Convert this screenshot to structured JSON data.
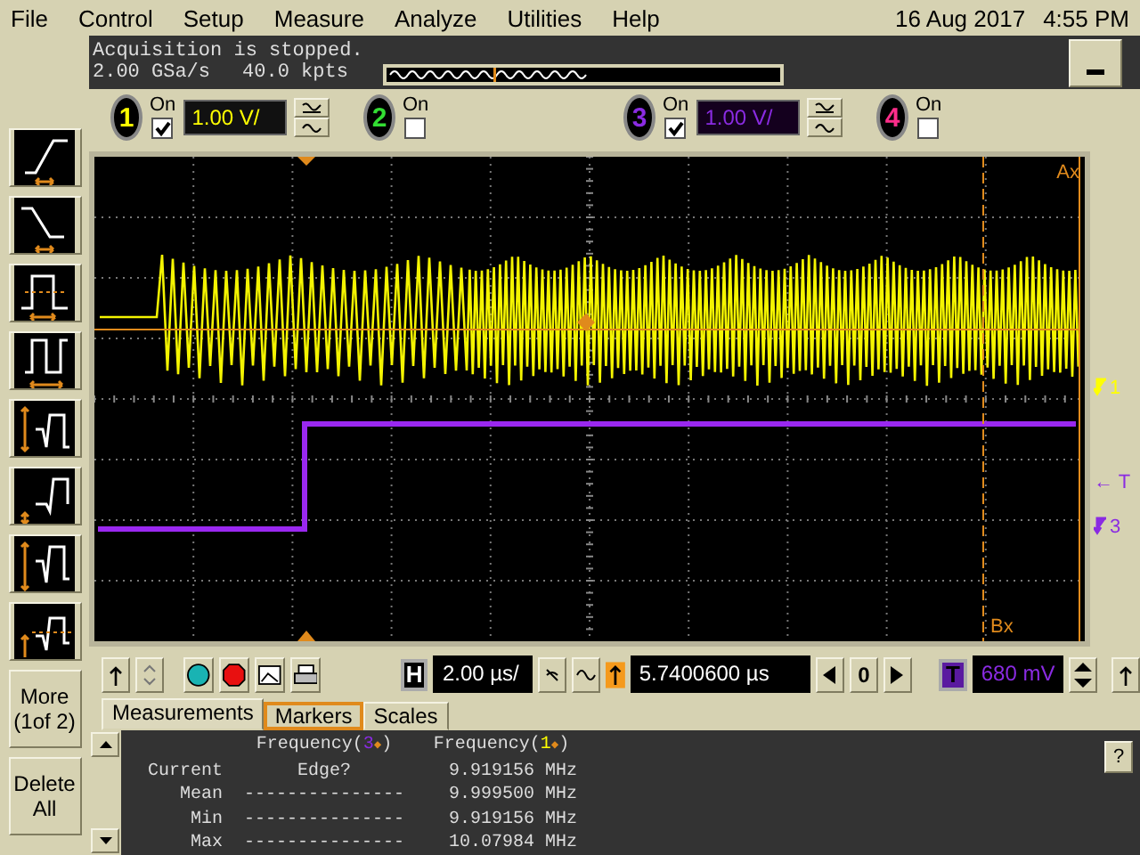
{
  "menu": [
    "File",
    "Control",
    "Setup",
    "Measure",
    "Analyze",
    "Utilities",
    "Help"
  ],
  "date": "16 Aug 2017",
  "time": "4:55 PM",
  "status": {
    "message": "Acquisition is stopped.",
    "sample_rate": "2.00 GSa/s",
    "memory": "40.0 kpts"
  },
  "channels": [
    {
      "number": "1",
      "on_label": "On",
      "on": true,
      "scale": "1.00 V/",
      "color": "#ffff00"
    },
    {
      "number": "2",
      "on_label": "On",
      "on": false,
      "color": "#33dd33"
    },
    {
      "number": "3",
      "on_label": "On",
      "on": true,
      "scale": "1.00 V/",
      "color": "#8a2be2"
    },
    {
      "number": "4",
      "on_label": "On",
      "on": false,
      "color": "#ff2d8a"
    }
  ],
  "measure_panel": {
    "more": "More\n(1of 2)",
    "delete": "Delete\nAll"
  },
  "display": {
    "markers": [
      "Ax",
      "Bx"
    ],
    "level_labels": [
      {
        "kind": "channel",
        "label": "1",
        "color": "#ffff00"
      },
      {
        "kind": "trigger",
        "label": "← T",
        "color": "#8a2be2"
      },
      {
        "kind": "channel",
        "label": "3",
        "color": "#8a2be2"
      }
    ]
  },
  "controls": {
    "horizontal_label": "H",
    "time_scale": "2.00 µs/",
    "delay": "5.7400600 µs",
    "delay_reference": "0",
    "trigger_label": "T",
    "trigger_level": "680 mV"
  },
  "tabs": [
    {
      "label": "Measurements",
      "selected": true,
      "focused": false
    },
    {
      "label": "Markers",
      "selected": false,
      "focused": true
    },
    {
      "label": "Scales",
      "selected": false,
      "focused": false
    }
  ],
  "measurements": {
    "help": "?",
    "columns": [
      {
        "label": "Frequency(",
        "channel": "3",
        "marker": "◆",
        "end": ")",
        "color": "#8a2be2"
      },
      {
        "label": "Frequency(",
        "channel": "1",
        "marker": "◆",
        "end": ")",
        "color": "#ffff00"
      }
    ],
    "rows": [
      {
        "label": "Current",
        "values": [
          "Edge?",
          "9.919156 MHz"
        ]
      },
      {
        "label": "Mean",
        "values": [
          "---------------",
          "9.999500 MHz"
        ]
      },
      {
        "label": "Min",
        "values": [
          "---------------",
          "9.919156 MHz"
        ]
      },
      {
        "label": "Max",
        "values": [
          "---------------",
          "10.07984 MHz"
        ]
      }
    ]
  }
}
